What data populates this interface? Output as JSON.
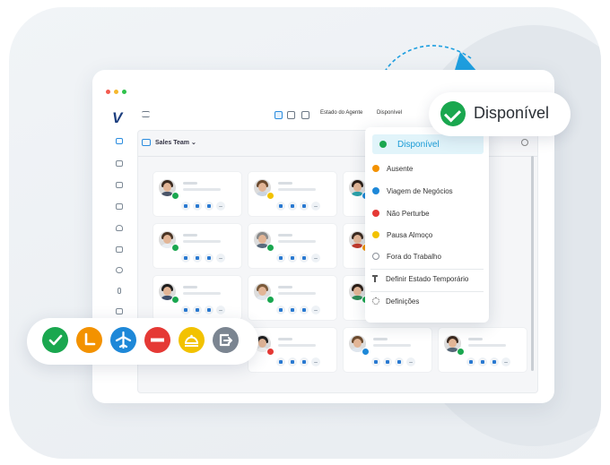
{
  "toolbar": {
    "agent_state_label": "Estado do Agente",
    "agent_state_value": "Disponível"
  },
  "panel": {
    "title": "Sales Team"
  },
  "status_pill": {
    "label": "Disponível",
    "color": "#1aa74f"
  },
  "dropdown": {
    "items": [
      {
        "label": "Disponível",
        "color": "#1aa74f",
        "icon": "check-icon"
      },
      {
        "label": "Ausente",
        "color": "#f39200",
        "icon": "clock-icon"
      },
      {
        "label": "Viagem de Negócios",
        "color": "#1e88d8",
        "icon": "plane-icon"
      },
      {
        "label": "Não Perturbe",
        "color": "#e53935",
        "icon": "minus-icon"
      },
      {
        "label": "Pausa Almoço",
        "color": "#f2c200",
        "icon": "cloche-icon"
      },
      {
        "label": "Fora do Trabalho",
        "color": "#8a9099",
        "icon": "exit-icon"
      }
    ],
    "temp_state": "Definir Estado Temporário",
    "settings": "Definições"
  },
  "status_icons": [
    "check-icon",
    "clock-icon",
    "plane-icon",
    "minus-icon",
    "cloche-icon",
    "exit-icon"
  ]
}
